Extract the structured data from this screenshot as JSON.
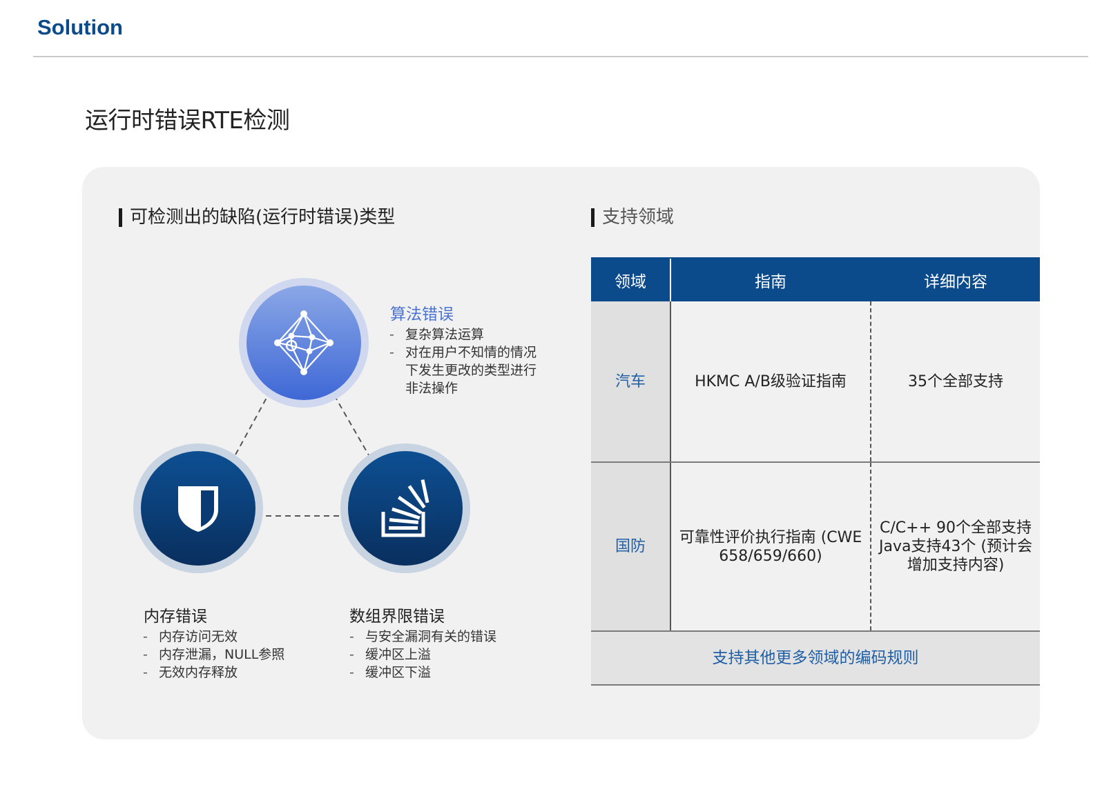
{
  "header": {
    "title": "Solution"
  },
  "page_title": "运行时错误RTE检测",
  "left_section": {
    "heading": "可检测出的缺陷(运行时错误)类型",
    "nodes": [
      {
        "icon": "network-icon",
        "title": "算法错误",
        "bullets": [
          "复杂算法运算",
          "对在用户不知情的情况",
          "下发生更改的类型进行",
          "非法操作"
        ]
      },
      {
        "icon": "shield-icon",
        "title": "内存错误",
        "bullets": [
          "内存访问无效",
          "内存泄漏，NULL参照",
          "无效内存释放"
        ]
      },
      {
        "icon": "stack-icon",
        "title": "数组界限错误",
        "bullets": [
          "与安全漏洞有关的错误",
          "缓冲区上溢",
          "缓冲区下溢"
        ]
      }
    ]
  },
  "right_section": {
    "heading": "支持领域",
    "table": {
      "headers": [
        "领域",
        "指南",
        "详细内容"
      ],
      "rows": [
        {
          "domain": "汽车",
          "guide": "HKMC A/B级验证指南",
          "detail": "35个全部支持"
        },
        {
          "domain": "国防",
          "guide": "可靠性评价执行指南 (CWE 658/659/660)",
          "detail": "C/C++ 90个全部支持 Java支持43个 (预计会增加支持内容)"
        }
      ],
      "footer": "支持其他更多领域的编码规则"
    }
  },
  "colors": {
    "brand_blue": "#0b4a8b",
    "accent_blue": "#4a72d0",
    "panel_bg": "#f1f1f1"
  }
}
